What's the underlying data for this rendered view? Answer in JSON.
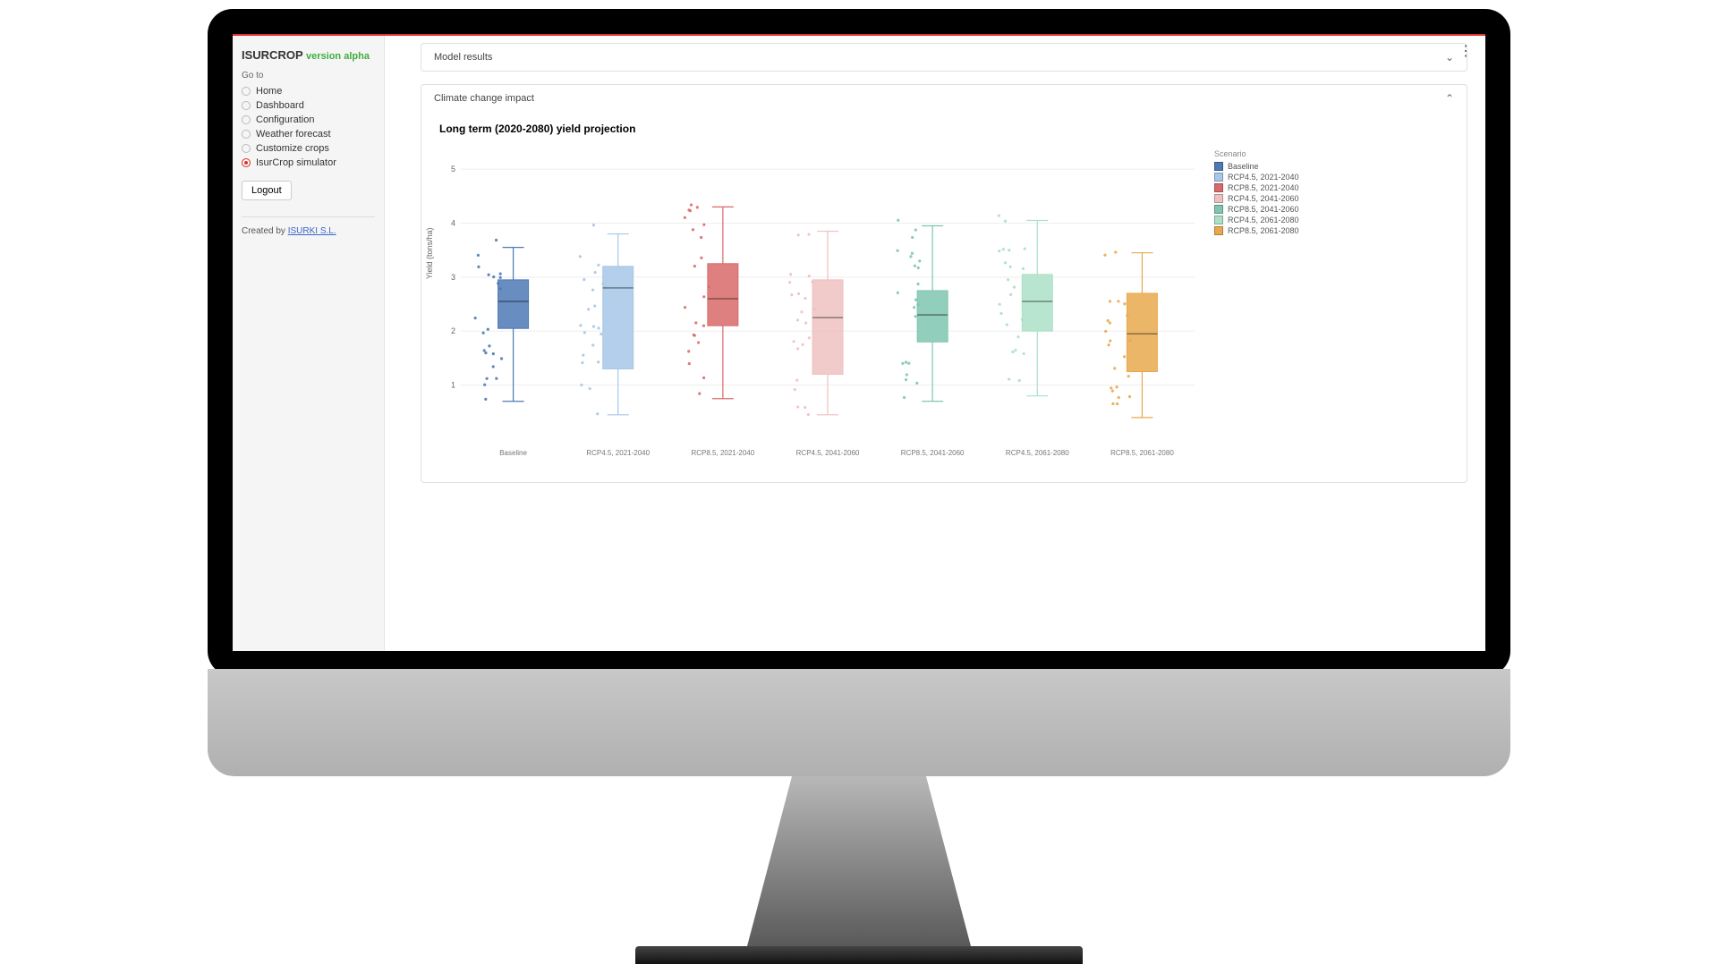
{
  "brand": {
    "name": "ISURCROP",
    "version": "version alpha"
  },
  "sidebar": {
    "goto_label": "Go to",
    "items": [
      {
        "label": "Home",
        "active": false
      },
      {
        "label": "Dashboard",
        "active": false
      },
      {
        "label": "Configuration",
        "active": false
      },
      {
        "label": "Weather forecast",
        "active": false
      },
      {
        "label": "Customize crops",
        "active": false
      },
      {
        "label": "IsurCrop simulator",
        "active": true
      }
    ],
    "logout_label": "Logout",
    "credit_prefix": "Created by ",
    "credit_link": "ISURKI S.L."
  },
  "panels": {
    "model_results": {
      "title": "Model results",
      "expanded": false
    },
    "climate_impact": {
      "title": "Climate change impact",
      "expanded": true
    }
  },
  "chart_title": "Long term (2020-2080) yield projection",
  "chart_data": {
    "type": "box",
    "ylabel": "Yield (tons/ha)",
    "ylim": [
      0,
      5.3
    ],
    "yticks": [
      1,
      2,
      3,
      4,
      5
    ],
    "legend_title": "Scenario",
    "categories": [
      "Baseline",
      "RCP4.5, 2021-2040",
      "RCP8.5, 2021-2040",
      "RCP4.5, 2041-2060",
      "RCP8.5, 2041-2060",
      "RCP4.5, 2061-2080",
      "RCP8.5, 2061-2080"
    ],
    "series": [
      {
        "name": "Baseline",
        "color": "#4d79b5",
        "min": 0.7,
        "q1": 2.05,
        "median": 2.55,
        "q3": 2.95,
        "max": 3.55
      },
      {
        "name": "RCP4.5, 2021-2040",
        "color": "#a7c7e7",
        "min": 0.45,
        "q1": 1.3,
        "median": 2.8,
        "q3": 3.2,
        "max": 3.8
      },
      {
        "name": "RCP8.5, 2021-2040",
        "color": "#d96a6a",
        "min": 0.75,
        "q1": 2.1,
        "median": 2.6,
        "q3": 3.25,
        "max": 4.3
      },
      {
        "name": "RCP4.5, 2041-2060",
        "color": "#eec1c1",
        "min": 0.45,
        "q1": 1.2,
        "median": 2.25,
        "q3": 2.95,
        "max": 3.85
      },
      {
        "name": "RCP8.5, 2041-2060",
        "color": "#7fc5b0",
        "min": 0.7,
        "q1": 1.8,
        "median": 2.3,
        "q3": 2.75,
        "max": 3.95
      },
      {
        "name": "RCP4.5, 2061-2080",
        "color": "#abe0c7",
        "min": 0.8,
        "q1": 2.0,
        "median": 2.55,
        "q3": 3.05,
        "max": 4.05
      },
      {
        "name": "RCP8.5, 2061-2080",
        "color": "#e8a94e",
        "min": 0.4,
        "q1": 1.25,
        "median": 1.95,
        "q3": 2.7,
        "max": 3.45
      }
    ]
  }
}
